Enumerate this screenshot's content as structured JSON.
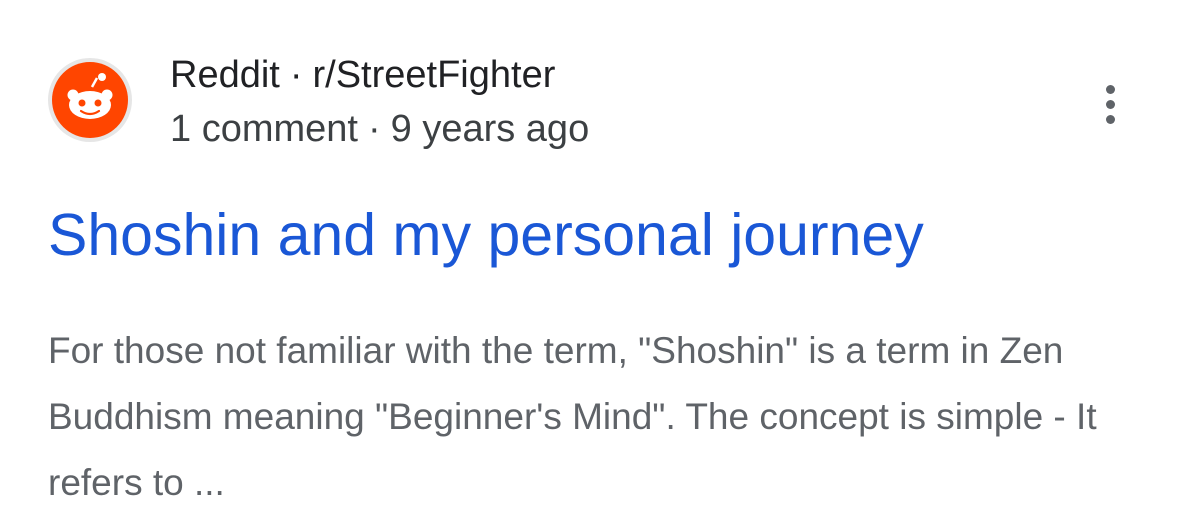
{
  "result": {
    "source": {
      "site": "Reddit",
      "separator": "·",
      "subreddit": "r/StreetFighter",
      "icon": "reddit-alien-icon"
    },
    "meta": {
      "comments": "1 comment",
      "separator": "·",
      "age": "9 years ago"
    },
    "title": "Shoshin and my personal journey",
    "snippet": "For those not familiar with the term, \"Shoshin\" is a term in Zen Buddhism meaning \"Beginner's Mind\". The concept is simple - It refers to ...",
    "menu_icon": "more-vert-icon"
  },
  "colors": {
    "reddit_orange": "#ff4500",
    "link_blue": "#1a57d6",
    "text_dark": "#202124",
    "text_gray": "#5f6368"
  }
}
